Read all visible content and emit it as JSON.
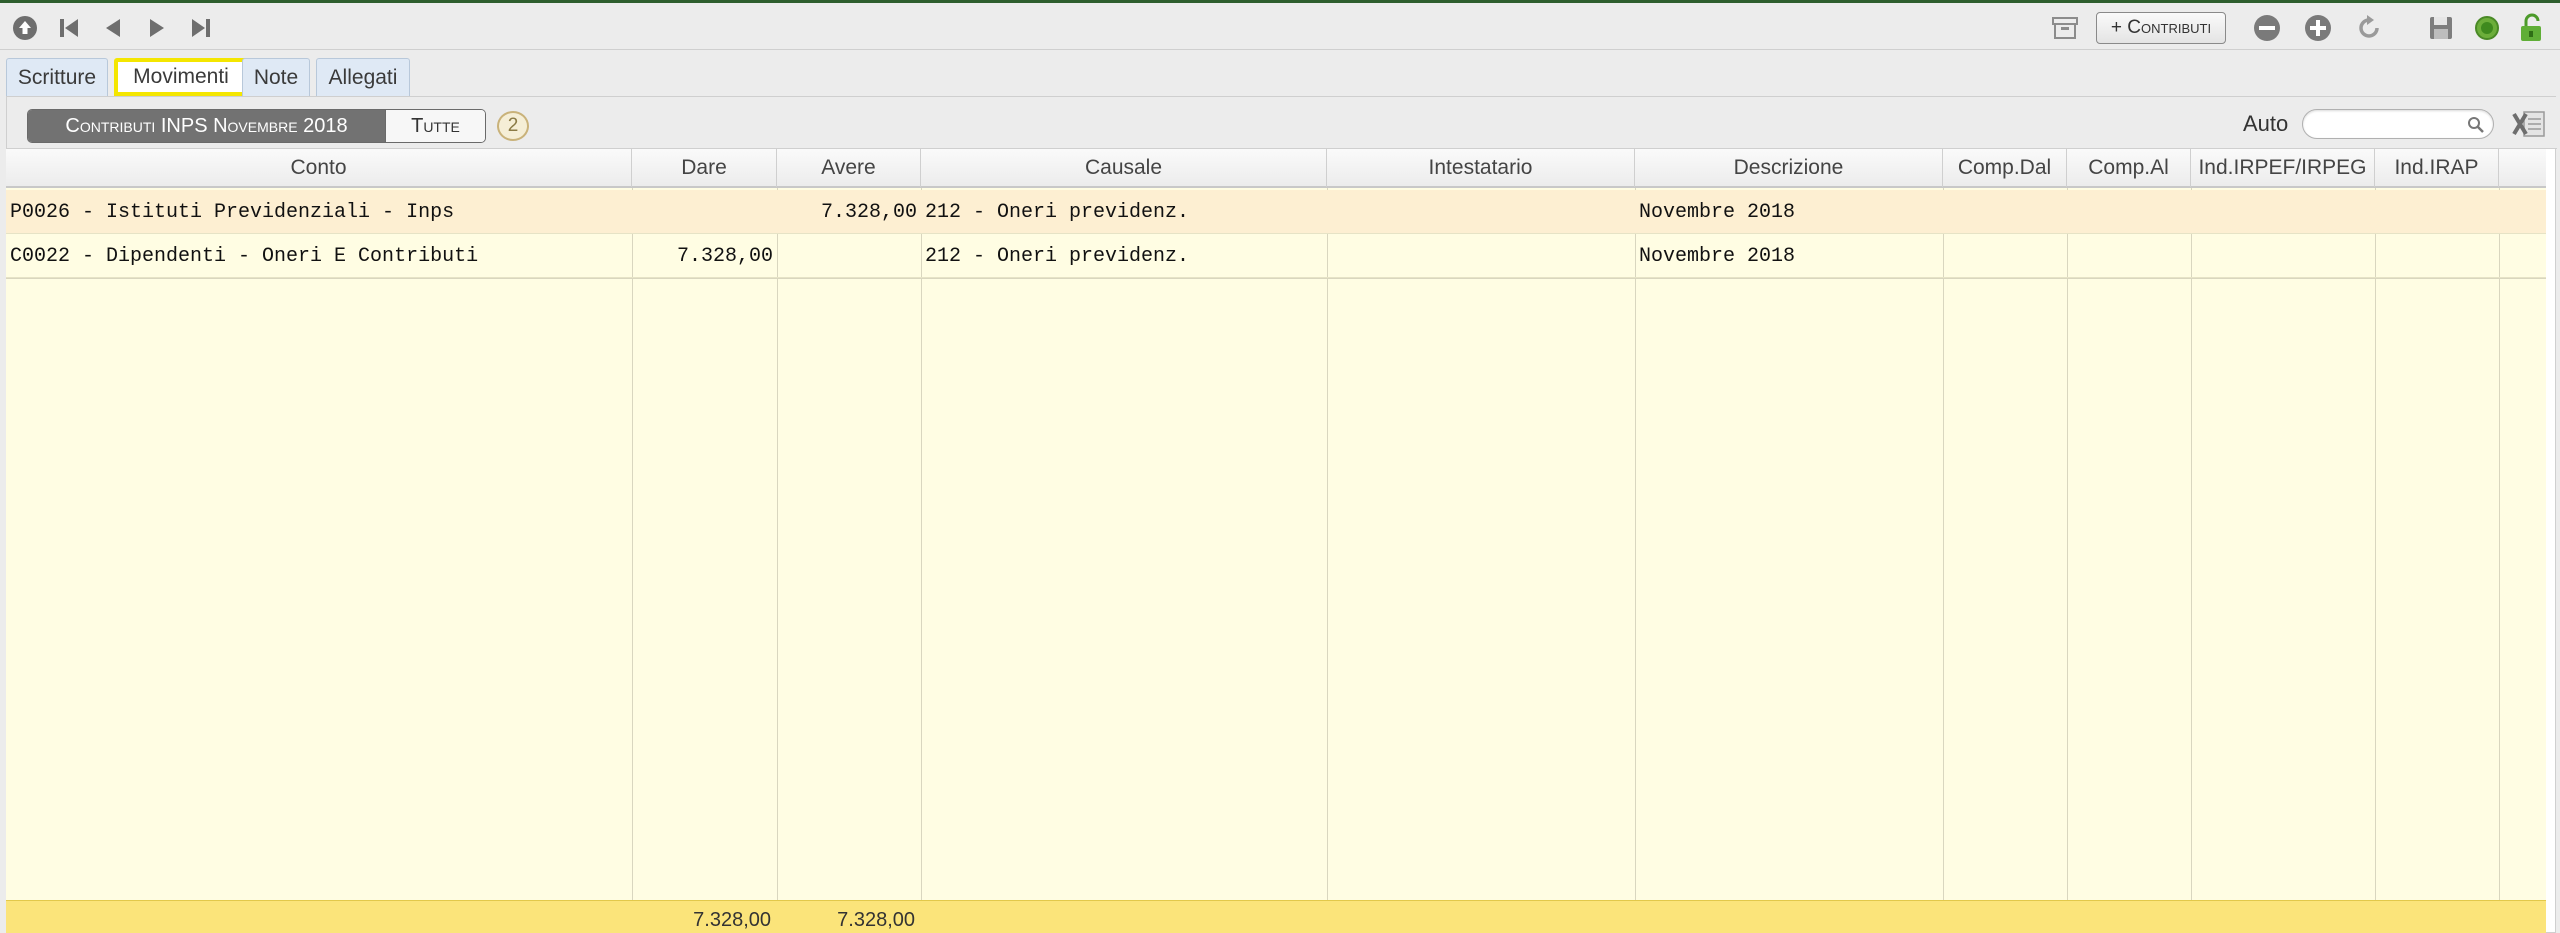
{
  "toolbar": {
    "icons": [
      "home-icon",
      "first-record-icon",
      "previous-record-icon",
      "next-record-icon",
      "last-record-icon",
      "archive-icon",
      "remove-icon",
      "add-icon",
      "refresh-icon",
      "save-icon",
      "status-icon",
      "lock-icon"
    ],
    "contributi_button": "+ Contributi"
  },
  "tabs": [
    {
      "label": "Scritture",
      "active": false
    },
    {
      "label": "Movimenti",
      "active": true
    },
    {
      "label": "Note",
      "active": false
    },
    {
      "label": "Allegati",
      "active": false
    }
  ],
  "filter": {
    "segment_selected": "Contributi INPS Novembre 2018",
    "segment_other": "Tutte",
    "count": "2",
    "auto_label": "Auto",
    "search_value": ""
  },
  "table": {
    "columns": [
      "Conto",
      "Dare",
      "Avere",
      "Causale",
      "Intestatario",
      "Descrizione",
      "Comp.Dal",
      "Comp.Al",
      "Ind.IRPEF/IRPEG",
      "Ind.IRAP"
    ],
    "rows": [
      {
        "conto": "P0026 - Istituti Previdenziali - Inps",
        "dare": "",
        "avere": "7.328,00",
        "causale": "212 - Oneri previdenz.",
        "intestatario": "",
        "descrizione": "Novembre 2018",
        "comp_dal": "",
        "comp_al": "",
        "ind_irpef": "",
        "ind_irap": ""
      },
      {
        "conto": "C0022 - Dipendenti - Oneri E Contributi",
        "dare": "7.328,00",
        "avere": "",
        "causale": "212 - Oneri previdenz.",
        "intestatario": "",
        "descrizione": "Novembre 2018",
        "comp_dal": "",
        "comp_al": "",
        "ind_irpef": "",
        "ind_irap": ""
      }
    ],
    "totals": {
      "dare": "7.328,00",
      "avere": "7.328,00"
    }
  },
  "colors": {
    "accent_highlight": "#f4e600",
    "grid_background": "#fffde3",
    "selected_row": "#fdefd2",
    "footer_background": "#fbe47a"
  }
}
